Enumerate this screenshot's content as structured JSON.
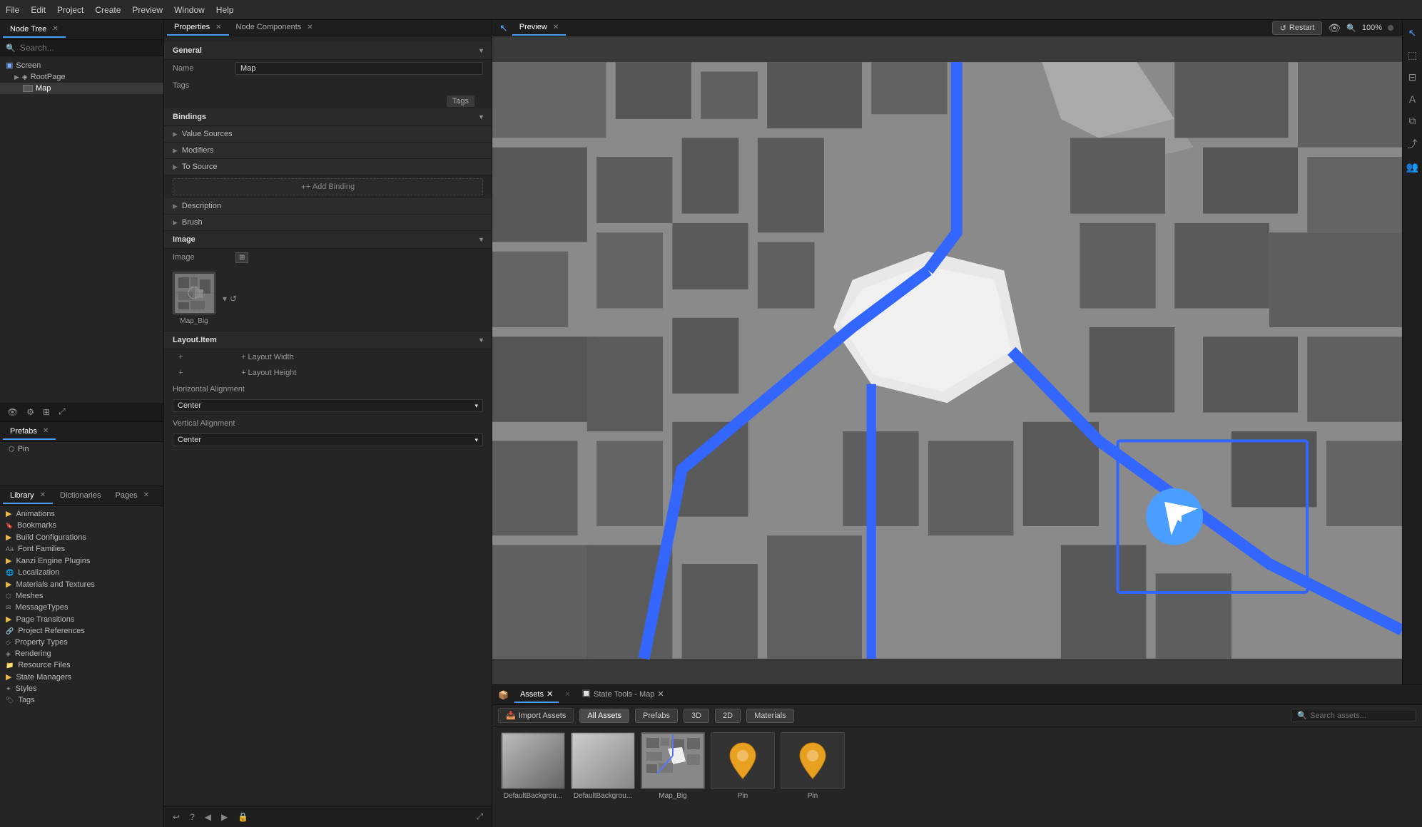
{
  "app": {
    "title": "Node Tree"
  },
  "menu": {
    "items": [
      "File",
      "Edit",
      "Project",
      "Create",
      "Preview",
      "Window",
      "Help"
    ]
  },
  "node_tree": {
    "tab_label": "Node Tree",
    "search_placeholder": "Search...",
    "tree": [
      {
        "label": "Screen",
        "level": 0,
        "type": "monitor"
      },
      {
        "label": "RootPage",
        "level": 1,
        "type": "node"
      },
      {
        "label": "Map",
        "level": 2,
        "type": "image"
      }
    ]
  },
  "properties": {
    "tab1_label": "Properties",
    "tab2_label": "Node Components",
    "general_label": "General",
    "name_label": "Name",
    "name_value": "Map",
    "tags_label": "Tags",
    "tags_btn": "Tags",
    "bindings_label": "Bindings",
    "value_sources_label": "Value Sources",
    "modifiers_label": "Modifiers",
    "to_source_label": "To Source",
    "add_binding_label": "+ Add Binding",
    "description_label": "Description",
    "brush_label": "Brush",
    "image_label": "Image",
    "image_field_label": "Image",
    "image_thumbnail_name": "Map_Big",
    "layout_item_label": "Layout.Item",
    "layout_width_label": "+ Layout Width",
    "layout_height_label": "+ Layout Height",
    "horizontal_alignment_label": "Horizontal Alignment",
    "horizontal_alignment_value": "Center",
    "vertical_alignment_label": "Vertical Alignment",
    "vertical_alignment_value": "Center"
  },
  "prefabs": {
    "tab_label": "Prefabs",
    "items": [
      {
        "label": "Pin",
        "type": "prefab"
      }
    ]
  },
  "library": {
    "tab1_label": "Library",
    "tab2_label": "Dictionaries",
    "tab3_label": "Pages",
    "items": [
      {
        "label": "Animations",
        "type": "folder",
        "expandable": true
      },
      {
        "label": "Bookmarks",
        "type": "item"
      },
      {
        "label": "Build Configurations",
        "type": "folder",
        "expandable": true
      },
      {
        "label": "Font Families",
        "type": "item"
      },
      {
        "label": "Kanzi Engine Plugins",
        "type": "folder",
        "expandable": true
      },
      {
        "label": "Localization",
        "type": "item"
      },
      {
        "label": "Materials and Textures",
        "type": "folder",
        "expandable": true
      },
      {
        "label": "Meshes",
        "type": "item"
      },
      {
        "label": "MessageTypes",
        "type": "item"
      },
      {
        "label": "Page Transitions",
        "type": "folder",
        "expandable": true
      },
      {
        "label": "Project References",
        "type": "item"
      },
      {
        "label": "Property Types",
        "type": "item"
      },
      {
        "label": "Rendering",
        "type": "item"
      },
      {
        "label": "Resource Files",
        "type": "item"
      },
      {
        "label": "State Managers",
        "type": "folder",
        "expandable": true
      },
      {
        "label": "Styles",
        "type": "item"
      },
      {
        "label": "Tags",
        "type": "item"
      }
    ]
  },
  "preview": {
    "tab_label": "Preview",
    "restart_btn": "Restart",
    "zoom_level": "100%"
  },
  "assets": {
    "tab1_label": "Assets",
    "tab2_label": "State Tools - Map",
    "import_btn": "Import Assets",
    "filters": [
      "All Assets",
      "Prefabs",
      "3D",
      "2D",
      "Materials"
    ],
    "active_filter": "All Assets",
    "search_placeholder": "Search assets...",
    "items": [
      {
        "label": "DefaultBackgrou...",
        "type": "gradient_gray"
      },
      {
        "label": "DefaultBackgrou...",
        "type": "gradient_light"
      },
      {
        "label": "Map_Big",
        "type": "map"
      },
      {
        "label": "Pin",
        "type": "pin_orange"
      },
      {
        "label": "Pin",
        "type": "pin_orange"
      }
    ]
  },
  "toolbar": {
    "icons": [
      "cursor",
      "move",
      "layout",
      "text",
      "layers",
      "share",
      "people"
    ]
  }
}
